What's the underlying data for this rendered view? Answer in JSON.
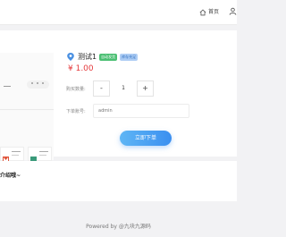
{
  "header": {
    "home_label": "首页"
  },
  "product": {
    "title": "测试1",
    "badges": [
      "自动发货",
      "库存充足"
    ],
    "price": "¥ 1.00"
  },
  "form": {
    "quantity_label": "购买数量:",
    "minus": "-",
    "quantity_value": "1",
    "plus": "+",
    "account_label": "下单账号:",
    "account_placeholder": "admin"
  },
  "actions": {
    "buy_label": "立即下单"
  },
  "section": {
    "title": "介绍哦~"
  },
  "footer": {
    "text": "Powered by @九块九源码"
  },
  "colors": {
    "accent": "#3b8ff0",
    "price": "#e4393c",
    "badge_green": "#4bbf73",
    "badge_blue": "#aecdf4"
  },
  "icons": {
    "home": "home-icon",
    "user": "user-icon",
    "product": "location-pin-icon"
  }
}
